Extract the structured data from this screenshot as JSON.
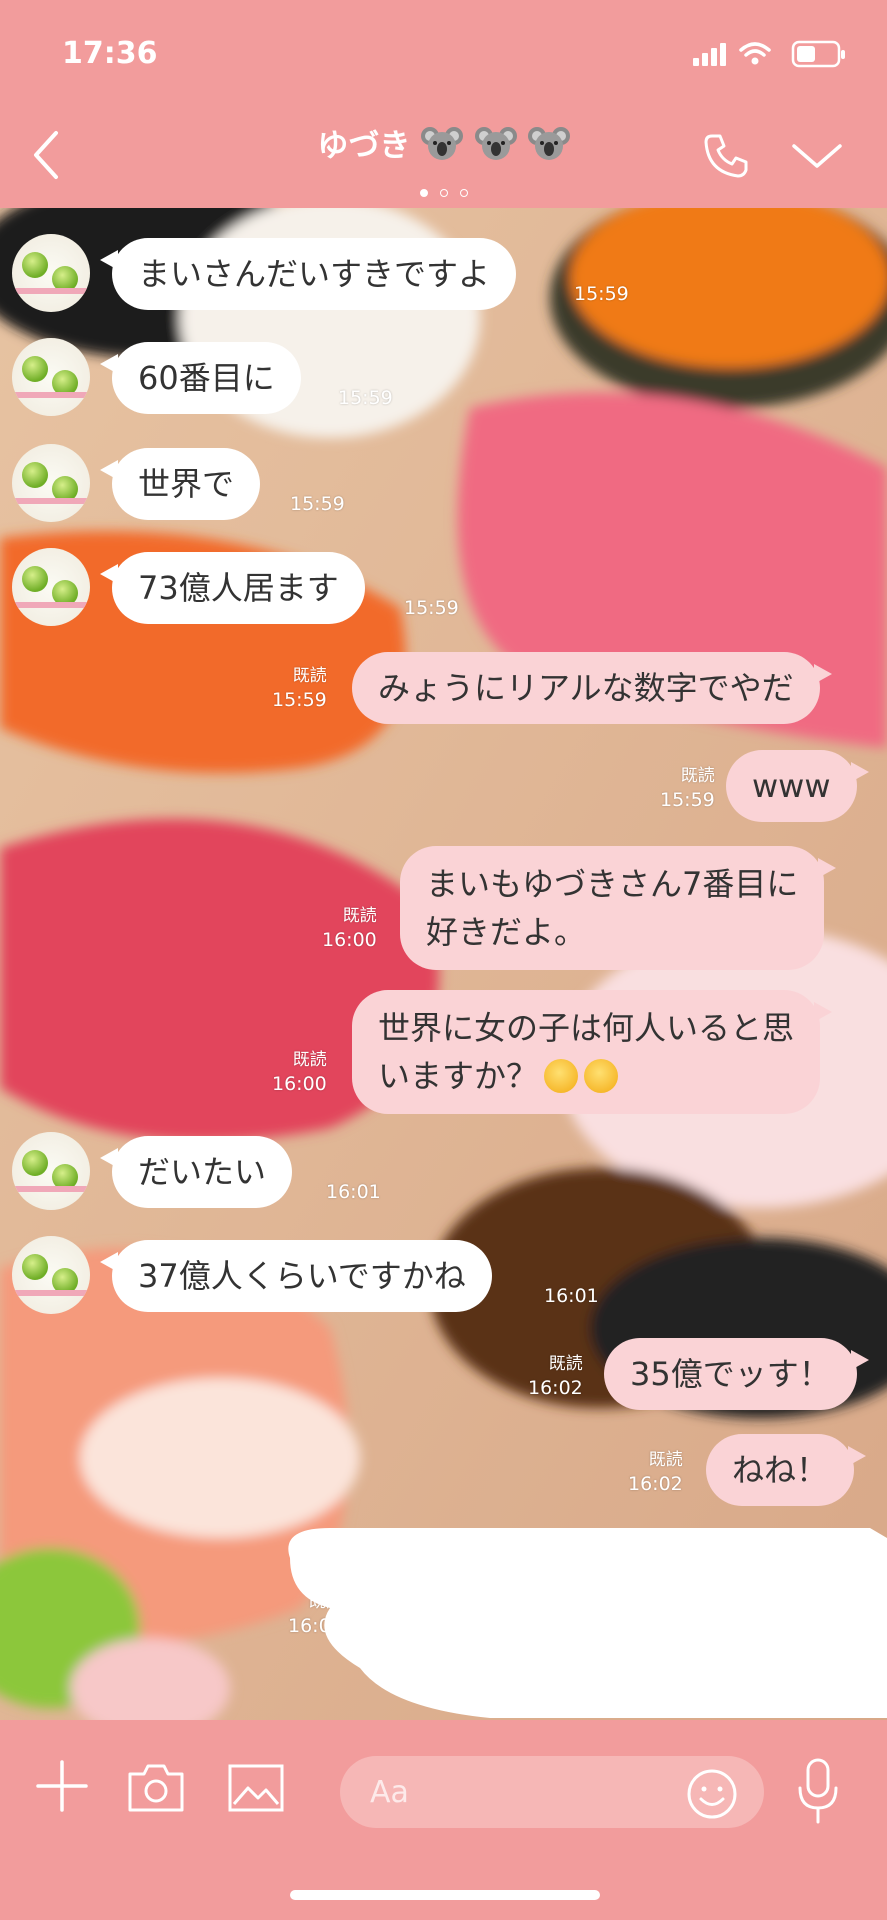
{
  "status_bar": {
    "time": "17:36"
  },
  "header": {
    "title": "ゆづき",
    "title_icons": [
      "koala-icon",
      "koala-icon",
      "koala-icon"
    ],
    "page_dots": 3
  },
  "colors": {
    "theme": "#f29c9c",
    "incoming_bubble": "#ffffff",
    "outgoing_bubble": "#fad3d6"
  },
  "messages": [
    {
      "side": "in",
      "text": "まいさんだいすきですよ",
      "time": "15:59"
    },
    {
      "side": "in",
      "text": "60番目に",
      "time": "15:59"
    },
    {
      "side": "in",
      "text": "世界で",
      "time": "15:59"
    },
    {
      "side": "in",
      "text": "73億人居ます",
      "time": "15:59"
    },
    {
      "side": "out",
      "text": "みょうにリアルな数字でやだ",
      "read": "既読",
      "time": "15:59"
    },
    {
      "side": "out",
      "text": "www",
      "read": "既読",
      "time": "15:59"
    },
    {
      "side": "out",
      "text_line1": "まいもゆづきさん7番目に",
      "text_line2": "好きだよ。",
      "read": "既読",
      "time": "16:00"
    },
    {
      "side": "out",
      "text_line1": "世界に女の子は何人いると思",
      "text_line2": "いますか？",
      "emojis": [
        "sneezing-face-icon",
        "pleading-face-icon"
      ],
      "read": "既読",
      "time": "16:00"
    },
    {
      "side": "in",
      "text": "だいたい",
      "time": "16:01"
    },
    {
      "side": "in",
      "text": "37億人くらいですかね",
      "time": "16:01"
    },
    {
      "side": "out",
      "text": "35億でッす！",
      "read": "既読",
      "time": "16:02"
    },
    {
      "side": "out",
      "text": "ねね！",
      "read": "既読",
      "time": "16:02"
    },
    {
      "side": "out",
      "text": "",
      "read": "既読",
      "time": "16:02",
      "redacted": true
    }
  ],
  "input_bar": {
    "placeholder": "Aa"
  }
}
